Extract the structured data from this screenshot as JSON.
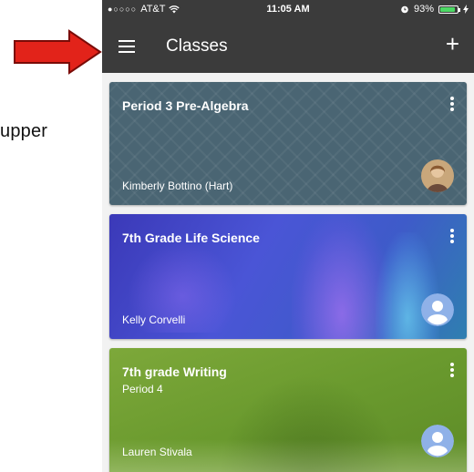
{
  "annotation": {
    "text": "upper"
  },
  "status_bar": {
    "carrier": "AT&T",
    "signal_dots": "●○○○○",
    "time": "11:05 AM",
    "battery": "93%"
  },
  "app_bar": {
    "title": "Classes",
    "add_label": "+"
  },
  "classes": [
    {
      "title": "Period 3 Pre-Algebra",
      "subtitle": "",
      "teacher": "Kimberly Bottino (Hart)"
    },
    {
      "title": "7th Grade Life Science",
      "subtitle": "",
      "teacher": "Kelly Corvelli"
    },
    {
      "title": "7th grade Writing",
      "subtitle": "Period 4",
      "teacher": "Lauren Stivala"
    }
  ],
  "colors": {
    "arrow": "#e2231a",
    "app_bar": "#3b3b3b",
    "card1": "#4a6573",
    "card2": "#3b39b8",
    "card3": "#6a9a2e",
    "avatar_default": "#8fb1e8"
  }
}
